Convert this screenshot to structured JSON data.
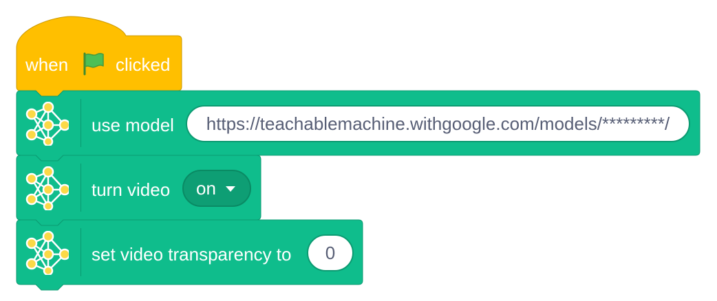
{
  "hat": {
    "label_when": "when",
    "flag_icon": "green-flag-icon",
    "label_clicked": "clicked",
    "color": "#ffbf00"
  },
  "blocks": [
    {
      "label": "use model",
      "input_value": "https://teachablemachine.withgoogle.com/models/*********/",
      "icon": "neural-network-icon"
    },
    {
      "label": "turn video",
      "dropdown_value": "on",
      "icon": "neural-network-icon"
    },
    {
      "label": "set video transparency to",
      "input_value": "0",
      "icon": "neural-network-icon"
    }
  ],
  "colors": {
    "extension_block": "#0fbd8c",
    "extension_border": "#0b9a71",
    "events_block": "#ffbf00",
    "events_border": "#cc9900"
  }
}
